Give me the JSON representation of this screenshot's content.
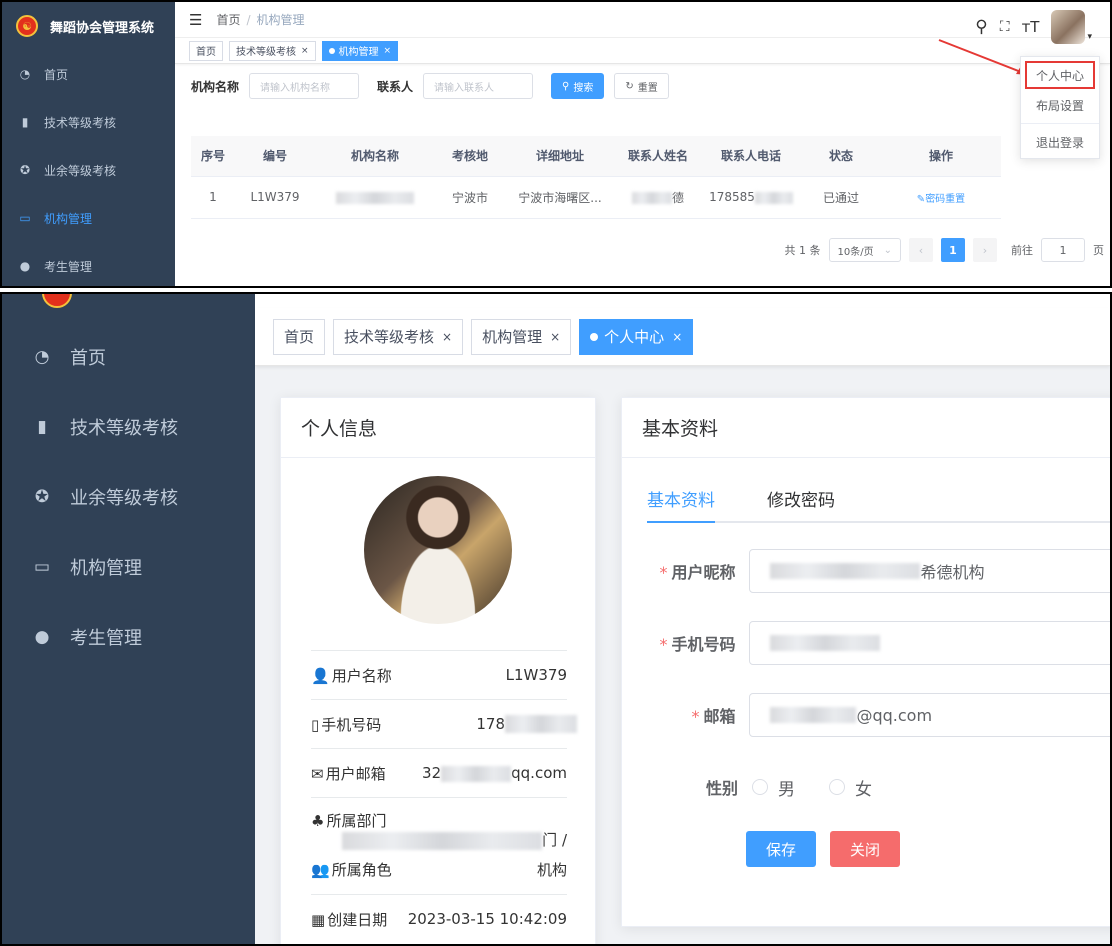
{
  "app": {
    "title": "舞蹈协会管理系统",
    "colors": {
      "primary": "#409eff",
      "sidebar": "#304156",
      "danger": "#f56c6c",
      "highlight": "#e53935"
    }
  },
  "sidebar": {
    "items": [
      {
        "label": "首页",
        "icon": "dashboard-icon"
      },
      {
        "label": "技术等级考核",
        "icon": "bar-chart-icon"
      },
      {
        "label": "业余等级考核",
        "icon": "aperture-icon"
      },
      {
        "label": "机构管理",
        "icon": "monitor-icon"
      },
      {
        "label": "考生管理",
        "icon": "user-icon"
      }
    ]
  },
  "header": {
    "breadcrumb": [
      "首页",
      "机构管理"
    ]
  },
  "tags1": [
    {
      "label": "首页"
    },
    {
      "label": "技术等级考核",
      "close": "×"
    },
    {
      "label": "机构管理",
      "close": "×"
    }
  ],
  "tags2": [
    {
      "label": "首页"
    },
    {
      "label": "技术等级考核",
      "close": "×"
    },
    {
      "label": "机构管理",
      "close": "×"
    },
    {
      "label": "个人中心",
      "close": "×"
    }
  ],
  "search": {
    "org_name_label": "机构名称",
    "org_name_placeholder": "请输入机构名称",
    "contact_label": "联系人",
    "contact_placeholder": "请输入联系人",
    "search_btn": "搜索",
    "reset_btn": "重置"
  },
  "table": {
    "headers": [
      "序号",
      "编号",
      "机构名称",
      "考核地",
      "详细地址",
      "联系人姓名",
      "联系人电话",
      "状态",
      "操作"
    ],
    "rows": [
      {
        "index": "1",
        "code": "L1W379",
        "location": "宁波市",
        "address": "宁波市海曙区...",
        "contact_suffix": "德",
        "phone_prefix": "178585",
        "status": "已通过",
        "action": "密码重置"
      }
    ]
  },
  "pagination": {
    "total": "共 1 条",
    "page_size": "10条/页",
    "current": "1",
    "goto_label": "前往",
    "goto_value": "1",
    "page_unit": "页"
  },
  "user_menu": {
    "items": [
      "个人中心",
      "布局设置",
      "退出登录"
    ]
  },
  "profile": {
    "title": "个人信息",
    "rows": {
      "username": {
        "label": "用户名称",
        "value": "L1W379"
      },
      "phone": {
        "label": "手机号码",
        "value": "178"
      },
      "email": {
        "label": "用户邮箱",
        "prefix": "32",
        "suffix": "qq.com"
      },
      "dept": {
        "label": "所属部门",
        "suffix": "门 /"
      },
      "role": {
        "label": "所属角色",
        "value": "机构"
      },
      "created": {
        "label": "创建日期",
        "value": "2023-03-15 10:42:09"
      }
    }
  },
  "basic": {
    "title": "基本资料",
    "tabs": [
      "基本资料",
      "修改密码"
    ],
    "fields": {
      "nickname": {
        "label": "用户昵称",
        "suffix": "希德机构"
      },
      "phone": {
        "label": "手机号码"
      },
      "email": {
        "label": "邮箱",
        "suffix": "@qq.com"
      },
      "gender": {
        "label": "性别",
        "options": [
          "男",
          "女"
        ]
      }
    },
    "save_btn": "保存",
    "close_btn": "关闭"
  }
}
